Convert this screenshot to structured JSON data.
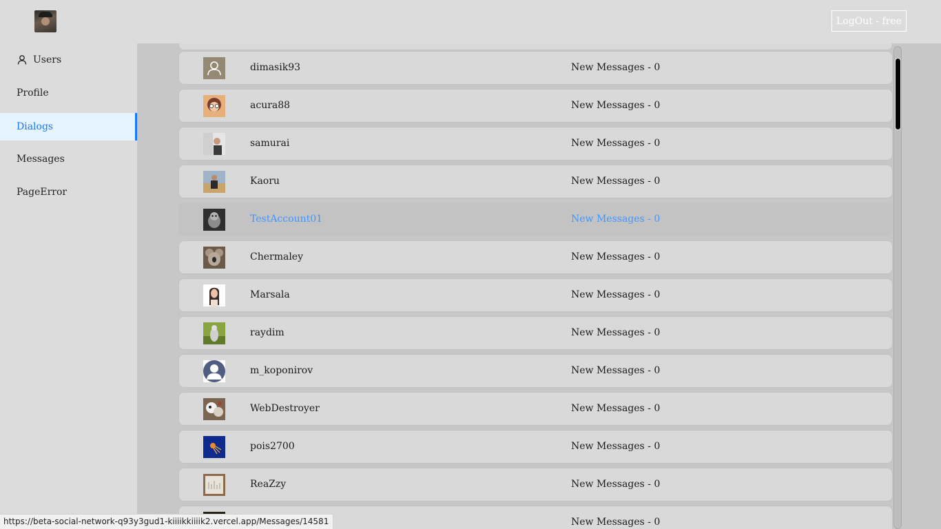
{
  "header": {
    "logout_label": "LogOut - free"
  },
  "sidebar": {
    "items": [
      {
        "label": "Users",
        "icon": "user-icon",
        "active": false
      },
      {
        "label": "Profile",
        "active": false
      },
      {
        "label": "Dialogs",
        "active": true
      },
      {
        "label": "Messages",
        "active": false
      },
      {
        "label": "PageError",
        "active": false
      }
    ]
  },
  "dialogs": [
    {
      "username": "dimasik93",
      "new_messages": "New Messages - 0"
    },
    {
      "username": "acura88",
      "new_messages": "New Messages - 0"
    },
    {
      "username": "samurai",
      "new_messages": "New Messages - 0"
    },
    {
      "username": "Kaoru",
      "new_messages": "New Messages - 0"
    },
    {
      "username": "TestAccount01",
      "new_messages": "New Messages - 0"
    },
    {
      "username": "Chermaley",
      "new_messages": "New Messages - 0"
    },
    {
      "username": "Marsala",
      "new_messages": "New Messages - 0"
    },
    {
      "username": "raydim",
      "new_messages": "New Messages - 0"
    },
    {
      "username": "m_koponirov",
      "new_messages": "New Messages - 0"
    },
    {
      "username": "WebDestroyer",
      "new_messages": "New Messages - 0"
    },
    {
      "username": "pois2700",
      "new_messages": "New Messages - 0"
    },
    {
      "username": "ReaZzy",
      "new_messages": "New Messages - 0"
    },
    {
      "username": "",
      "new_messages": "New Messages - 0"
    }
  ],
  "status_url": "https://beta-social-network-q93y3gud1-kiiiikkiiiik2.vercel.app/Messages/14581",
  "colors": {
    "accent": "#1677ff",
    "hover_text": "#4096ff",
    "active_bg": "#e6f4ff"
  }
}
